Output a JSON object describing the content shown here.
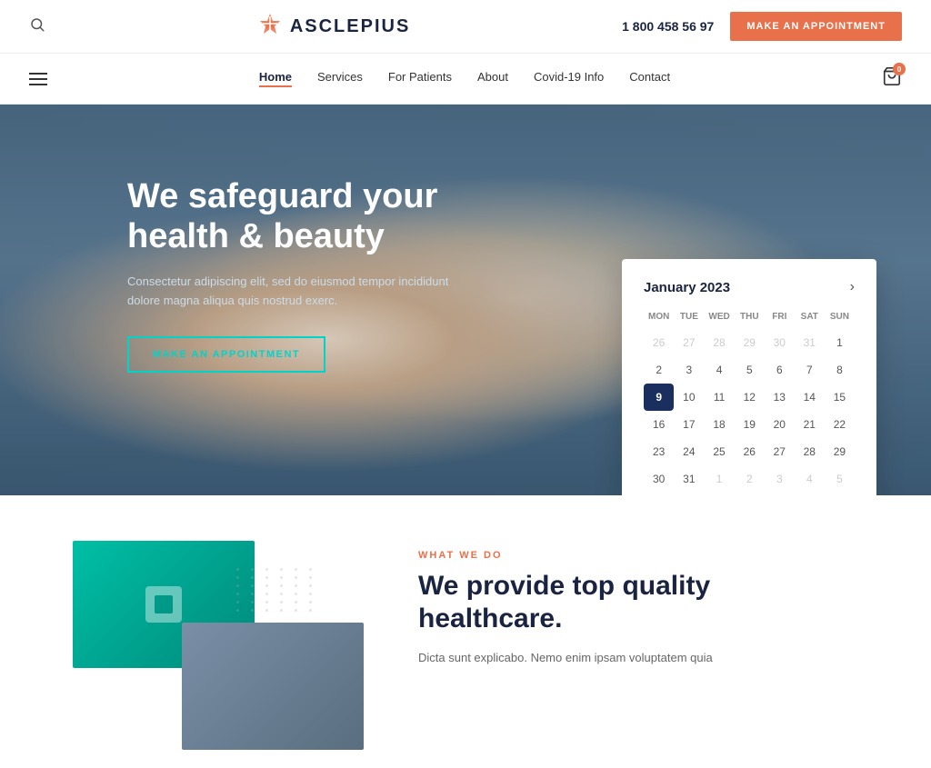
{
  "header": {
    "search_icon": "🔍",
    "logo_icon": "✦",
    "logo_text": "ASCLEPIUS",
    "phone": "1 800 458 56 97",
    "appt_btn": "MAKE AN APPOINTMENT"
  },
  "nav": {
    "links": [
      {
        "label": "Home",
        "active": true
      },
      {
        "label": "Services",
        "active": false
      },
      {
        "label": "For Patients",
        "active": false
      },
      {
        "label": "About",
        "active": false
      },
      {
        "label": "Covid-19 Info",
        "active": false
      },
      {
        "label": "Contact",
        "active": false
      }
    ]
  },
  "hero": {
    "title": "We safeguard your health & beauty",
    "description": "Consectetur adipiscing elit, sed do eiusmod tempor incididunt dolore magna aliqua quis nostrud exerc.",
    "appt_btn": "MAKE AN APPOINTMENT"
  },
  "calendar": {
    "month": "January 2023",
    "days_header": [
      "MON",
      "TUE",
      "WED",
      "THU",
      "FRI",
      "SAT",
      "SUN"
    ],
    "weeks": [
      [
        {
          "day": "26",
          "other": true
        },
        {
          "day": "27",
          "other": true
        },
        {
          "day": "28",
          "other": true
        },
        {
          "day": "29",
          "other": true
        },
        {
          "day": "30",
          "other": true
        },
        {
          "day": "31",
          "other": true
        },
        {
          "day": "1",
          "other": false
        }
      ],
      [
        {
          "day": "2",
          "other": false
        },
        {
          "day": "3",
          "other": false
        },
        {
          "day": "4",
          "other": false
        },
        {
          "day": "5",
          "other": false
        },
        {
          "day": "6",
          "other": false
        },
        {
          "day": "7",
          "other": false
        },
        {
          "day": "8",
          "other": false
        }
      ],
      [
        {
          "day": "9",
          "other": false,
          "selected": true
        },
        {
          "day": "10",
          "other": false
        },
        {
          "day": "11",
          "other": false
        },
        {
          "day": "12",
          "other": false
        },
        {
          "day": "13",
          "other": false
        },
        {
          "day": "14",
          "other": false
        },
        {
          "day": "15",
          "other": false
        }
      ],
      [
        {
          "day": "16",
          "other": false
        },
        {
          "day": "17",
          "other": false
        },
        {
          "day": "18",
          "other": false
        },
        {
          "day": "19",
          "other": false
        },
        {
          "day": "20",
          "other": false
        },
        {
          "day": "21",
          "other": false
        },
        {
          "day": "22",
          "other": false
        }
      ],
      [
        {
          "day": "23",
          "other": false
        },
        {
          "day": "24",
          "other": false
        },
        {
          "day": "25",
          "other": false
        },
        {
          "day": "26",
          "other": false
        },
        {
          "day": "27",
          "other": false
        },
        {
          "day": "28",
          "other": false
        },
        {
          "day": "29",
          "other": false
        }
      ],
      [
        {
          "day": "30",
          "other": false
        },
        {
          "day": "31",
          "other": false
        },
        {
          "day": "1",
          "other": true
        },
        {
          "day": "2",
          "other": true
        },
        {
          "day": "3",
          "other": true
        },
        {
          "day": "4",
          "other": true
        },
        {
          "day": "5",
          "other": true
        }
      ]
    ]
  },
  "section": {
    "label": "WHAT WE DO",
    "title": "We provide top quality healthcare.",
    "description": "Dicta sunt explicabo. Nemo enim ipsam voluptatem quia"
  }
}
